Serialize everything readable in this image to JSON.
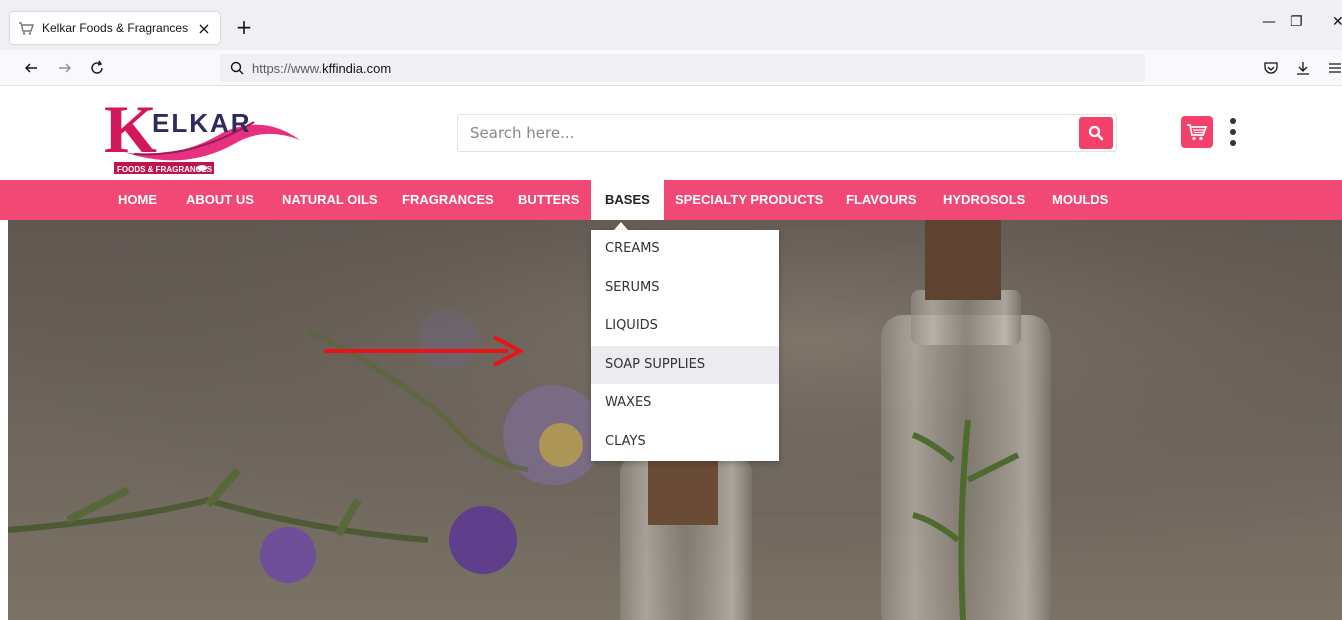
{
  "browser": {
    "tab_title": "Kelkar Foods & Fragrances",
    "tab_close": "×",
    "new_tab": "+",
    "url_prefix": "https://www.",
    "url_host": "kffindia.com",
    "window_controls": [
      "—",
      "❐",
      "✕"
    ]
  },
  "site": {
    "logo_text": "ELKAR",
    "logo_letter": "K",
    "logo_tagline": "FOODS & FRAGRANCES",
    "search_placeholder": "Search here...",
    "accent_color": "#f4416c"
  },
  "menu": {
    "items": [
      {
        "label": "HOME"
      },
      {
        "label": "ABOUT US"
      },
      {
        "label": "NATURAL OILS"
      },
      {
        "label": "FRAGRANCES"
      },
      {
        "label": "BUTTERS"
      },
      {
        "label": "BASES",
        "active": true
      },
      {
        "label": "SPECIALTY PRODUCTS"
      },
      {
        "label": "FLAVOURS"
      },
      {
        "label": "HYDROSOLS"
      },
      {
        "label": "MOULDS"
      }
    ]
  },
  "dropdown": {
    "items": [
      {
        "label": "CREAMS"
      },
      {
        "label": "SERUMS"
      },
      {
        "label": "LIQUIDS"
      },
      {
        "label": "SOAP SUPPLIES",
        "hover": true
      },
      {
        "label": "WAXES"
      },
      {
        "label": "CLAYS"
      }
    ]
  },
  "annotation": {
    "arrow_color": "#e8141a",
    "arrow_points_to": "SOAP SUPPLIES"
  }
}
